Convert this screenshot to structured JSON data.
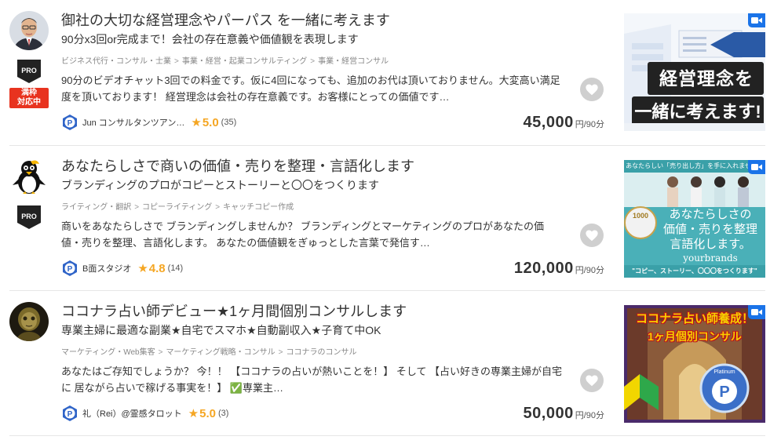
{
  "listings": [
    {
      "title": "御社の大切な経営理念やパーパス を一緒に考えます",
      "subtitle": "90分x3回or完成まで！会社の存在意義や価値観を表現します",
      "breadcrumb": [
        "ビジネス代行・コンサル・士業",
        "事業・経営・起業コンサルティング",
        "事業・経営コンサル"
      ],
      "description": "90分のビデオチャット3回での料金です。仮に4回になっても、追加のお代は頂いておりません。大変高い満足度を頂いております！ 経営理念は会社の存在意義です。お客様にとっての価値です…",
      "seller": "Jun コンサルタンツアン…",
      "rating": "5.0",
      "review_count": "(35)",
      "price": "45,000",
      "price_unit": "円/90分",
      "badge_pro": "PRO",
      "badge_full": "満枠\n対応中",
      "thumb_text_1": "経営理念を",
      "thumb_text_2": "一緒に考えます!"
    },
    {
      "title": "あなたらしさで商いの価値・売りを整理・言語化します",
      "subtitle": "ブランディングのプロがコピーとストーリーと〇〇をつくります",
      "breadcrumb": [
        "ライティング・翻訳",
        "コピーライティング",
        "キャッチコピー作成"
      ],
      "description": "商いをあなたらしさで ブランディングしませんか？ ブランディングとマーケティングのプロがあなたの価値・売りを整理、言語化します。 あなたの価値観をぎゅっとした言葉で発信す…",
      "seller": "B面スタジオ",
      "rating": "4.8",
      "review_count": "(14)",
      "price": "120,000",
      "price_unit": "円/90分",
      "badge_pro": "PRO",
      "thumb_top": "あなたらしい「売り出し方」を手に入れませんか",
      "thumb_l1": "あなたらしさの",
      "thumb_l2": "価値・売りを整理",
      "thumb_l3": "言語化します。",
      "thumb_brand": "yourbrands",
      "thumb_bottom": "\"コピー、ストーリー、〇〇〇をつくります\"",
      "thumb_seal": "1000"
    },
    {
      "title": "ココナラ占い師デビュー★1ヶ月間個別コンサルします",
      "subtitle": "専業主婦に最適な副業★自宅でスマホ★自動副収入★子育て中OK",
      "breadcrumb": [
        "マーケティング・Web集客",
        "マーケティング戦略・コンサル",
        "ココナラのコンサル"
      ],
      "description": "あなたはご存知でしょうか？ 今！！ 【ココナラの占いが熱いことを！】 そして 【占い好きの専業主婦が自宅に 居ながら占いで稼げる事実を！】 ✅専業主…",
      "seller": "礼（Rei）@霊感タロット",
      "rating": "5.0",
      "review_count": "(3)",
      "price": "50,000",
      "price_unit": "円/90分",
      "thumb_l1": "ココナラ占い師養成！",
      "thumb_l2": "1ヶ月個別コンサル",
      "thumb_badge": "Platinum"
    }
  ],
  "colors": {
    "star": "#f5a623",
    "full_badge": "#e8331f",
    "video_icon": "#1a73e8",
    "fav_bg": "#cfcfcf"
  },
  "icons": [
    "heart-icon",
    "star-icon",
    "video-icon",
    "platinum-p-icon",
    "pro-badge-icon"
  ]
}
